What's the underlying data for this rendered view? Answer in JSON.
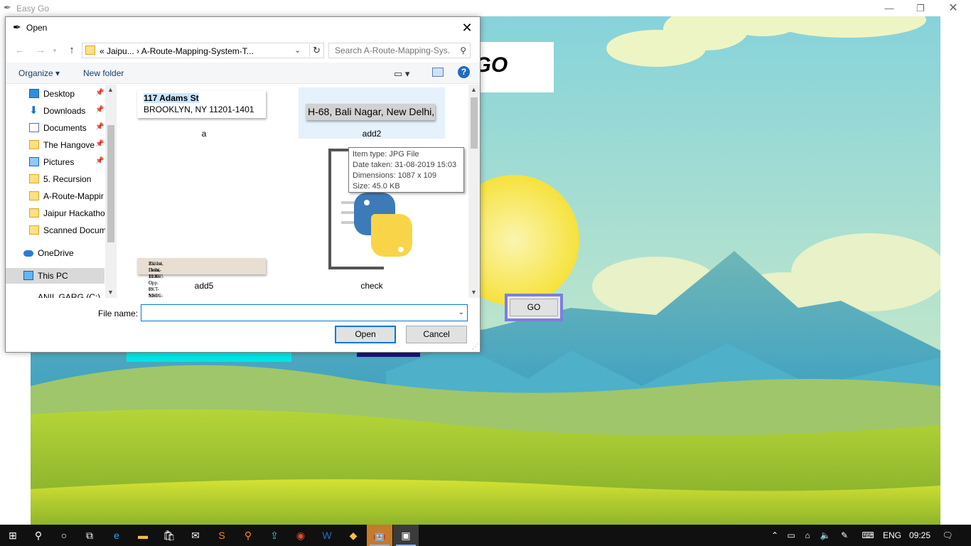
{
  "app": {
    "title": "Easy Go",
    "heading": "EASY GO",
    "go_button": "GO"
  },
  "dialog": {
    "title": "Open",
    "address": "« Jaipu... › A-Route-Mapping-System-T...",
    "search_placeholder": "Search A-Route-Mapping-Sys...",
    "organize": "Organize ▾",
    "new_folder": "New folder",
    "nav_items": [
      {
        "label": "Desktop",
        "icon": "desktop-icon",
        "pinned": true
      },
      {
        "label": "Downloads",
        "icon": "download-icon",
        "pinned": true
      },
      {
        "label": "Documents",
        "icon": "documents-icon",
        "pinned": true
      },
      {
        "label": "The Hangove",
        "icon": "folder-icon",
        "pinned": true
      },
      {
        "label": "Pictures",
        "icon": "pictures-icon",
        "pinned": true
      },
      {
        "label": "5. Recursion",
        "icon": "folder-icon",
        "pinned": false
      },
      {
        "label": "A-Route-Mappir",
        "icon": "folder-icon",
        "pinned": false
      },
      {
        "label": "Jaipur Hackatho",
        "icon": "folder-icon",
        "pinned": false
      },
      {
        "label": "Scanned Docum",
        "icon": "folder-icon",
        "pinned": false
      },
      {
        "label": "OneDrive",
        "icon": "onedrive-icon",
        "pinned": false
      },
      {
        "label": "This PC",
        "icon": "this-pc-icon",
        "pinned": false
      },
      {
        "label": "ANIL GARG (C:)",
        "icon": "drive-icon",
        "pinned": false
      }
    ],
    "files": [
      {
        "name": "a",
        "thumb_line1": "117 Adams St",
        "thumb_line2": "BROOKLYN, NY 11201-1401"
      },
      {
        "name": "add2",
        "thumb_text": "H-68, Bali Nagar, New Delhi,"
      },
      {
        "name": "add5",
        "thumb_line1": "23, 1st Floor, BLK-C, PKT-9,SEC-7,",
        "thumb_line2": "Rohini, Delhi-110085 Opp. to Metro Pillar No.400"
      },
      {
        "name": "check"
      }
    ],
    "tooltip": {
      "type": "Item type: JPG File",
      "date": "Date taken: 31-08-2019 15:03",
      "dimensions": "Dimensions: 1087 x 109",
      "size": "Size: 45.0 KB"
    },
    "file_name_label": "File name:",
    "file_name_value": "",
    "open_button": "Open",
    "cancel_button": "Cancel"
  },
  "taskbar": {
    "language": "ENG",
    "time": "09:25"
  },
  "colors": {
    "go_border": "#7b7fe0",
    "accent": "#0078d7",
    "cyan_strip": "#00e5e5",
    "navy_strip": "#17177a"
  }
}
